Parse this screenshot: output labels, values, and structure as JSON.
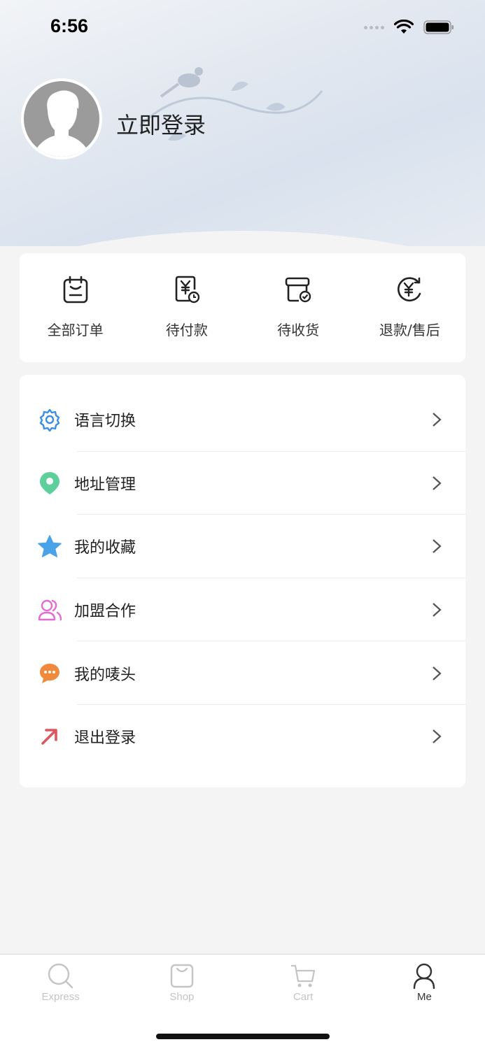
{
  "status": {
    "time": "6:56"
  },
  "profile": {
    "login_label": "立即登录"
  },
  "orders": [
    {
      "label": "全部订单",
      "icon": "clipboard-icon"
    },
    {
      "label": "待付款",
      "icon": "payment-pending-icon"
    },
    {
      "label": "待收货",
      "icon": "box-check-icon"
    },
    {
      "label": "退款/售后",
      "icon": "refund-icon"
    }
  ],
  "menu": [
    {
      "label": "语言切换",
      "icon": "gear-icon",
      "color": "#3a8ee6"
    },
    {
      "label": "地址管理",
      "icon": "location-pin-icon",
      "color": "#5ccf9a"
    },
    {
      "label": "我的收藏",
      "icon": "star-icon",
      "color": "#4aa3e8"
    },
    {
      "label": "加盟合作",
      "icon": "users-icon",
      "color": "#e66ad6"
    },
    {
      "label": "我的唛头",
      "icon": "chat-bubble-icon",
      "color": "#f0893a"
    },
    {
      "label": "退出登录",
      "icon": "arrow-up-right-icon",
      "color": "#d9595f"
    }
  ],
  "tabs": [
    {
      "label": "Express",
      "icon": "search-icon",
      "active": false
    },
    {
      "label": "Shop",
      "icon": "shopping-bag-icon",
      "active": false
    },
    {
      "label": "Cart",
      "icon": "cart-icon",
      "active": false
    },
    {
      "label": "Me",
      "icon": "user-icon",
      "active": true
    }
  ]
}
